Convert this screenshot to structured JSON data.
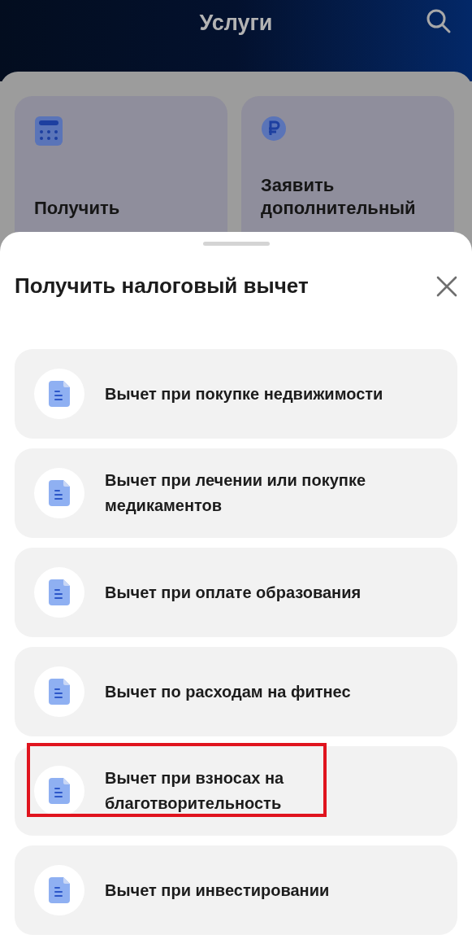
{
  "header": {
    "title": "Услуги"
  },
  "cards": [
    {
      "kind": "calendar",
      "label": "Получить"
    },
    {
      "kind": "ruble",
      "label": "Заявить дополнительный"
    }
  ],
  "sheet": {
    "title": "Получить налоговый вычет",
    "items": [
      {
        "label": "Вычет при покупке недвижимости",
        "highlighted": false
      },
      {
        "label": "Вычет при лечении или покупке медикаментов",
        "highlighted": false
      },
      {
        "label": "Вычет при оплате образования",
        "highlighted": false
      },
      {
        "label": "Вычет по расходам на фитнес",
        "highlighted": false
      },
      {
        "label": "Вычет при взносах на благотворительность",
        "highlighted": true
      },
      {
        "label": "Вычет при инвестировании",
        "highlighted": false
      }
    ]
  }
}
